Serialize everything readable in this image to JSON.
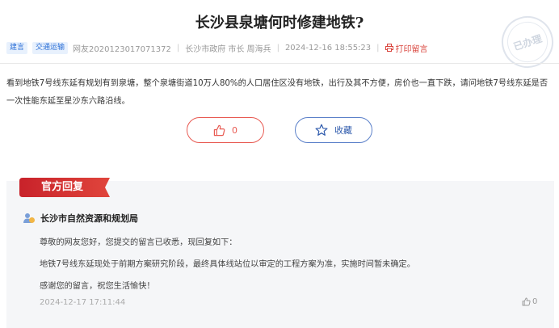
{
  "title": "长沙县泉塘何时修建地铁?",
  "stamp_text": "已办理",
  "meta": {
    "tags": [
      "建言",
      "交通运输"
    ],
    "user": "网友2020123017071372",
    "target": "长沙市政府 市长 周海兵",
    "datetime": "2024-12-16 18:55:23",
    "print_label": "打印留言"
  },
  "content": "看到地铁7号线东延有规划有到泉塘，整个泉塘街道10万人80%的人口居住区没有地铁，出行及其不方便，房价也一直下跌，请问地铁7号线东延是否一次性能东延至星沙东六路沿线。",
  "actions": {
    "like_count": "0",
    "favorite_label": "收藏"
  },
  "reply": {
    "badge": "官方回复",
    "department": "长沙市自然资源和规划局",
    "lines": [
      "尊敬的网友您好，您提交的留言已收悉，现回复如下：",
      "地铁7号线东延现处于前期方案研究阶段，最终具体线站位以审定的工程方案为准，实施时间暂未确定。",
      "感谢您的留言，祝您生活愉快！"
    ],
    "datetime": "2024-12-17 17:11:44",
    "like_count": "0"
  },
  "colors": {
    "accent_red": "#d9433b",
    "tag_blue": "#2b6fd6",
    "reply_bg": "#f5f6f8"
  }
}
